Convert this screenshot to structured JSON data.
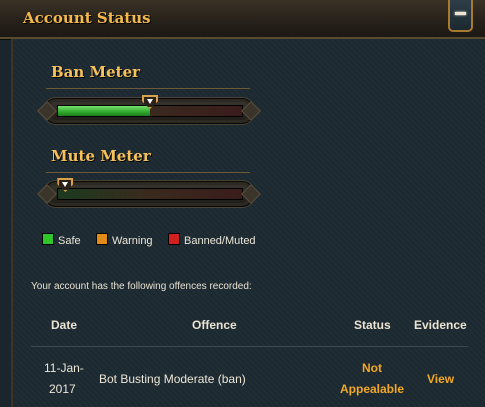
{
  "header": {
    "title": "Account Status",
    "collapse_icon": "minus-icon"
  },
  "ban_meter": {
    "title": "Ban Meter",
    "level_percent": 50
  },
  "mute_meter": {
    "title": "Mute Meter",
    "level_percent": 0
  },
  "legend": [
    {
      "label": "Safe",
      "color": "#2fc62a"
    },
    {
      "label": "Warning",
      "color": "#e08a1a"
    },
    {
      "label": "Banned/Muted",
      "color": "#d02020"
    }
  ],
  "offences_note": "Your account has the following offences recorded:",
  "table": {
    "headers": {
      "date": "Date",
      "offence": "Offence",
      "status": "Status",
      "evidence": "Evidence"
    },
    "rows": [
      {
        "date_line1": "11-Jan-",
        "date_line2": "2017",
        "offence": "Bot Busting Moderate (ban)",
        "status_line1": "Not",
        "status_line2": "Appealable",
        "evidence": "View"
      }
    ]
  },
  "colors": {
    "accent": "#f4b94a",
    "status_text": "#f2a824",
    "background": "#1d2a32"
  }
}
